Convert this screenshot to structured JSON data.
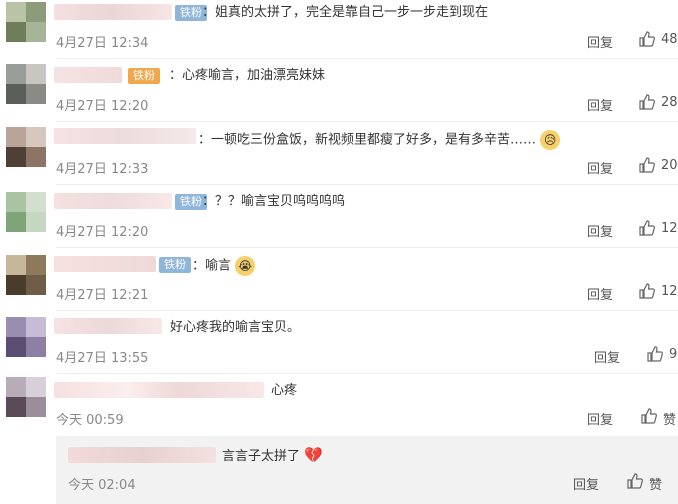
{
  "comments": [
    {
      "badge": "铁粉",
      "text": "：姐真的太拼了，完全是靠自己一步一步走到现在",
      "time": "4月27日 12:34",
      "reply": "回复",
      "likes": "48"
    },
    {
      "badge": "铁粉",
      "text": "：心疼喻言，加油漂亮妹妹",
      "time": "4月27日 12:20",
      "reply": "回复",
      "likes": "28"
    },
    {
      "badge": "",
      "text": "：一顿吃三份盒饭，新视频里都瘦了好多，是有多辛苦……",
      "time": "4月27日 12:33",
      "reply": "回复",
      "likes": "20"
    },
    {
      "badge": "铁粉",
      "text": "：？？喻言宝贝呜呜呜呜",
      "time": "4月27日 12:20",
      "reply": "回复",
      "likes": "12"
    },
    {
      "badge": "铁粉",
      "text": "：喻言",
      "time": "4月27日 12:21",
      "reply": "回复",
      "likes": "12"
    },
    {
      "badge": "",
      "text": "好心疼我的喻言宝贝。",
      "time": "4月27日 13:55",
      "reply": "回复",
      "likes": "9"
    },
    {
      "badge": "",
      "text": "心疼",
      "time": "今天 00:59",
      "reply": "回复",
      "likes": "赞"
    }
  ],
  "subreply": {
    "text": "言言子太拼了",
    "time": "今天 02:04",
    "reply": "回复",
    "likes": "赞"
  },
  "colors": {
    "badge": "#8fb6d9",
    "badge_fire": "#f0a84c",
    "subpanel": "#f2f2f2",
    "divider": "#eeeeee"
  }
}
